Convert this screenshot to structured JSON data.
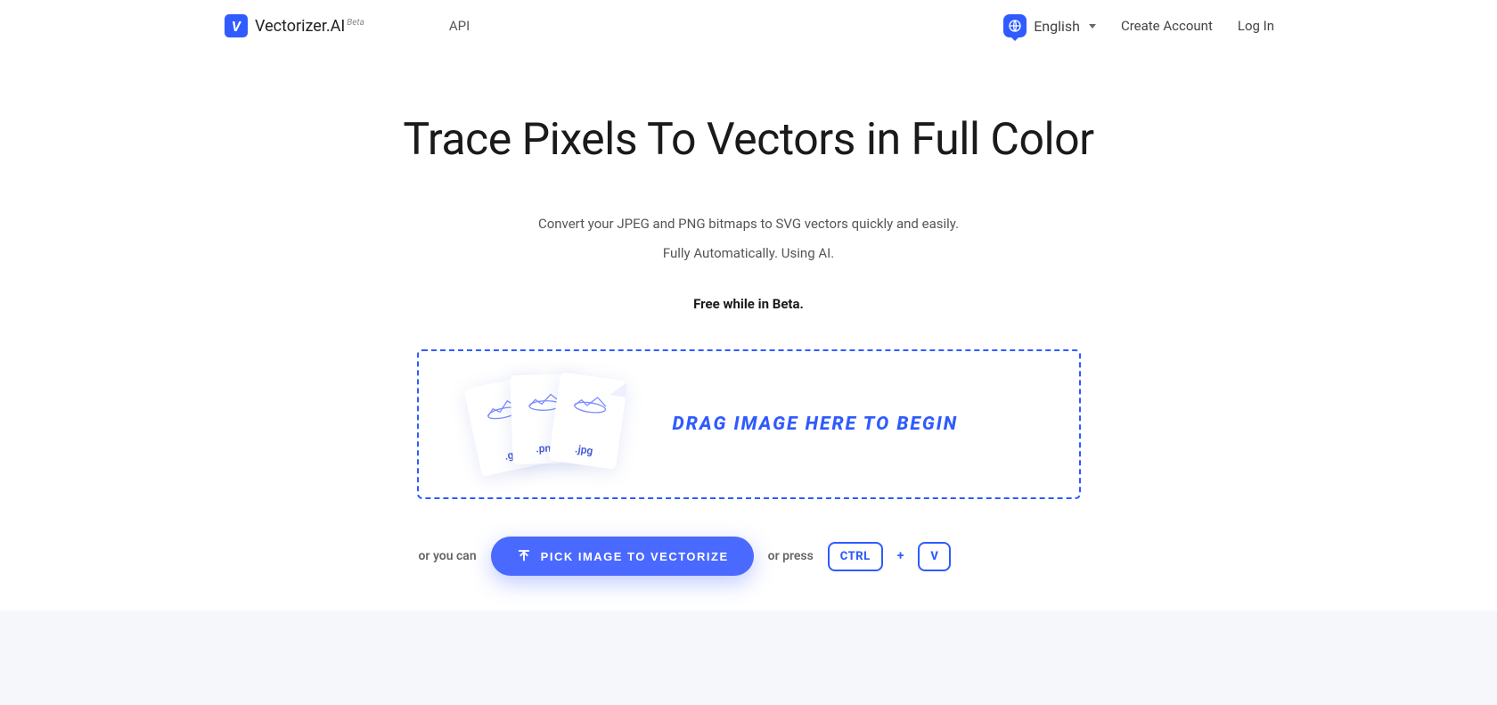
{
  "nav": {
    "brand_name": "Vectorizer.AI",
    "brand_letter": "V",
    "beta_label": "Beta",
    "api_link": "API",
    "language": "English",
    "create_account": "Create Account",
    "log_in": "Log In"
  },
  "hero": {
    "headline": "Trace Pixels To Vectors in Full Color",
    "sub_line1": "Convert your JPEG and PNG bitmaps to SVG vectors quickly and easily.",
    "sub_line2": "Fully Automatically. Using AI.",
    "beta_note": "Free while in Beta."
  },
  "dropzone": {
    "text": "DRAG IMAGE HERE TO BEGIN",
    "cards": [
      {
        "ext": ".gif"
      },
      {
        "ext": ".png"
      },
      {
        "ext": ".jpg"
      }
    ]
  },
  "actions": {
    "or_you_can": "or you can",
    "pick_button": "PICK IMAGE TO VECTORIZE",
    "or_press": "or press",
    "key_ctrl": "CTRL",
    "plus": "+",
    "key_v": "V"
  }
}
